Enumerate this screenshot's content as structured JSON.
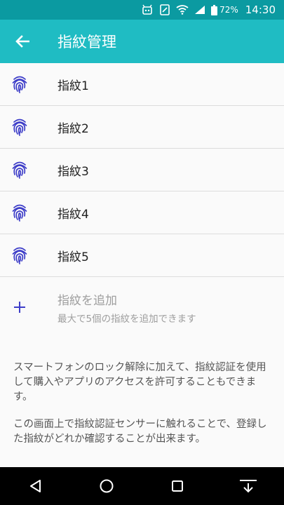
{
  "status_bar": {
    "battery": "72%",
    "time": "14:30"
  },
  "app_bar": {
    "title": "指紋管理"
  },
  "fingerprints": [
    {
      "label": "指紋1"
    },
    {
      "label": "指紋2"
    },
    {
      "label": "指紋3"
    },
    {
      "label": "指紋4"
    },
    {
      "label": "指紋5"
    }
  ],
  "add": {
    "label": "指紋を追加",
    "sublabel": "最大で5個の指紋を追加できます"
  },
  "info": {
    "paragraph1": "スマートフォンのロック解除に加えて、指紋認証を使用して購入やアプリのアクセスを許可することもできます。",
    "paragraph2": "この画面上で指紋認証センサーに触れることで、登録した指紋がどれか確認することが出来ます。"
  },
  "colors": {
    "status_bar": "#0b9aa1",
    "app_bar": "#1fbcc3",
    "accent": "#3d3dc8"
  }
}
